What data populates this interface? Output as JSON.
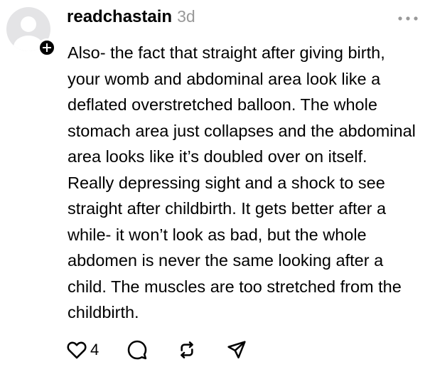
{
  "post": {
    "username": "readchastain",
    "time": "3d",
    "text": "Also- the fact that straight after giving birth, your womb and abdominal area look like a deflated overstretched balloon. The whole stomach area just collapses and the abdominal area looks like it’s doubled over on itself. Really depressing sight and a shock to see straight after childbirth. It gets better after a while- it won’t look as bad, but the whole abdomen is never the same looking after a child. The muscles are too stretched from the childbirth.",
    "like_count": "4"
  },
  "icons": {
    "avatar": "default-avatar-icon",
    "follow": "plus-icon",
    "more": "more-dots-icon",
    "like": "heart-icon",
    "comment": "comment-icon",
    "repost": "repost-icon",
    "share": "send-icon"
  },
  "colors": {
    "text": "#000000",
    "muted": "#999999",
    "avatar_bg": "#e4e4e6",
    "avatar_fg": "#ffffff"
  }
}
